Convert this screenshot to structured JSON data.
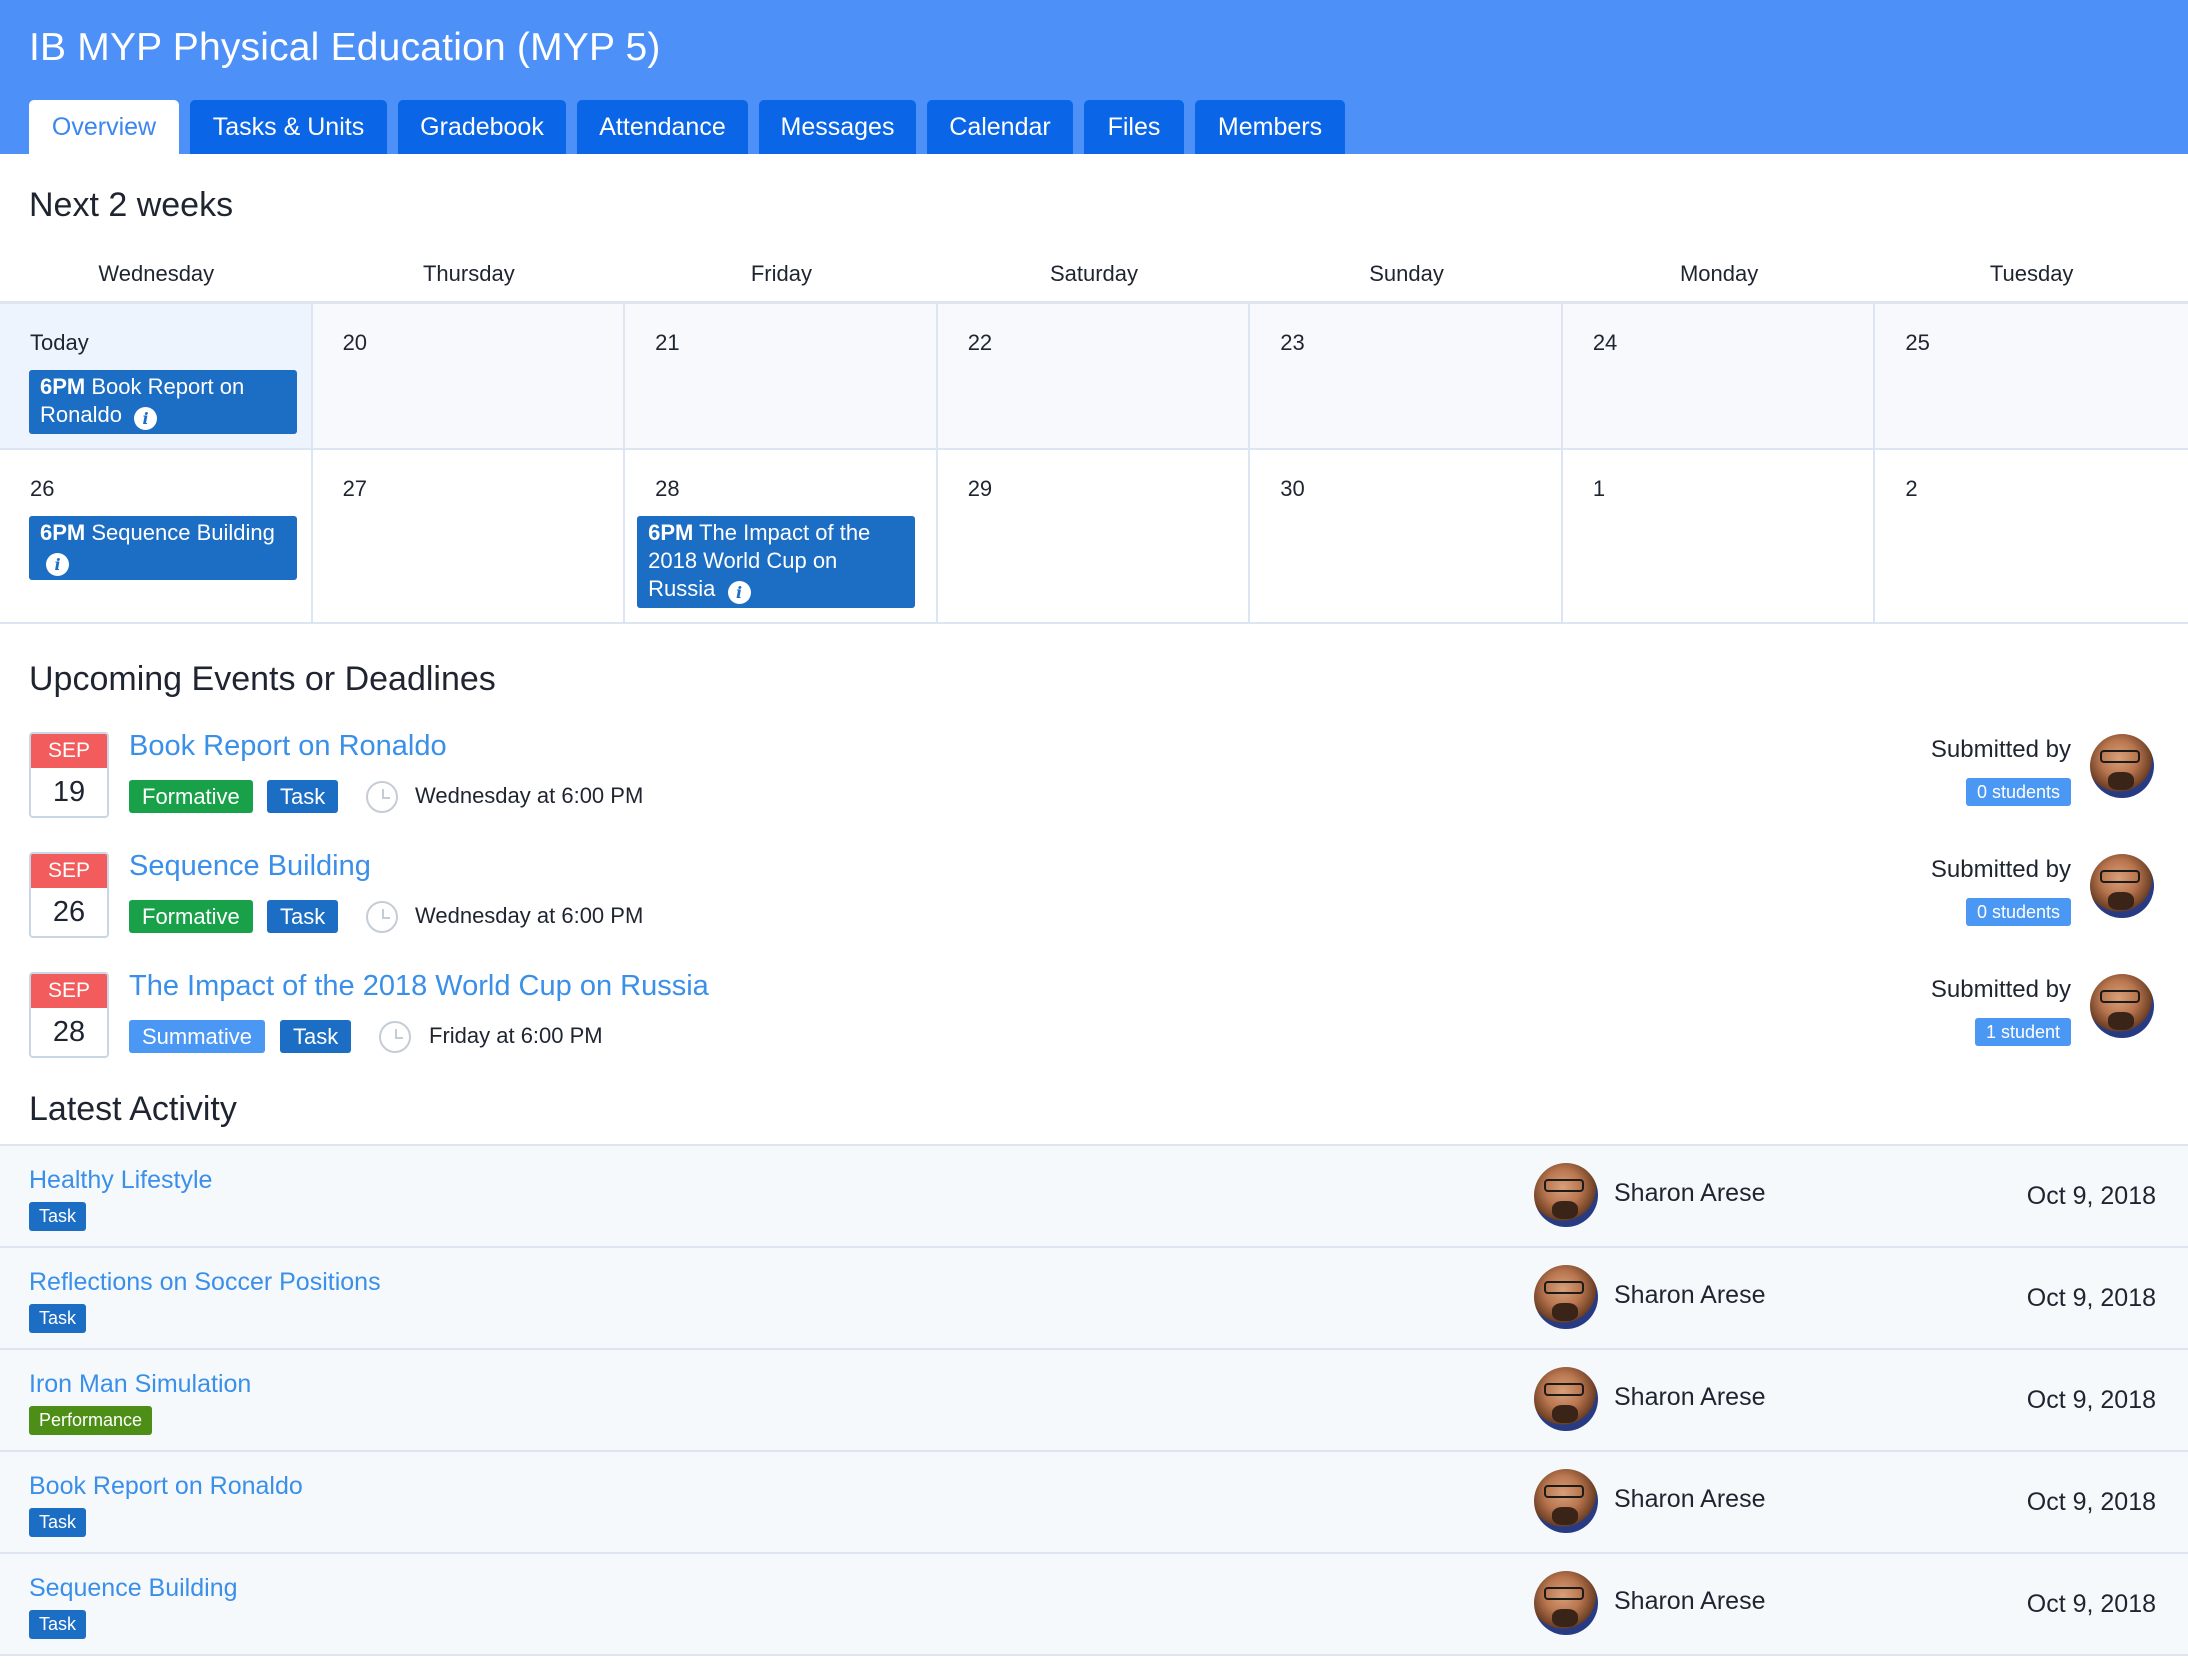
{
  "course": {
    "title": "IB MYP Physical Education (MYP 5)"
  },
  "tabs": [
    {
      "label": "Overview"
    },
    {
      "label": "Tasks & Units"
    },
    {
      "label": "Gradebook"
    },
    {
      "label": "Attendance"
    },
    {
      "label": "Messages"
    },
    {
      "label": "Calendar"
    },
    {
      "label": "Files"
    },
    {
      "label": "Members"
    }
  ],
  "active_tab": "Overview",
  "calendar": {
    "heading": "Next 2 weeks",
    "weekdays": [
      "Wednesday",
      "Thursday",
      "Friday",
      "Saturday",
      "Sunday",
      "Monday",
      "Tuesday"
    ],
    "week1": [
      "Today",
      "20",
      "21",
      "22",
      "23",
      "24",
      "25"
    ],
    "week2": [
      "26",
      "27",
      "28",
      "29",
      "30",
      "1",
      "2"
    ],
    "events": [
      {
        "time": "6PM",
        "title": "Book Report on Ronaldo"
      },
      {
        "time": "6PM",
        "title": "Sequence Building"
      },
      {
        "time": "6PM",
        "title": "The Impact of the 2018 World Cup on Russia"
      }
    ],
    "info_glyph": "i"
  },
  "upcoming": {
    "heading": "Upcoming Events or Deadlines",
    "submitted_label": "Submitted by",
    "items": [
      {
        "month": "SEP",
        "day": "19",
        "title": "Book Report on Ronaldo",
        "type": "Formative",
        "kind": "Task",
        "due": "Wednesday at 6:00 PM",
        "submitted": "0 students"
      },
      {
        "month": "SEP",
        "day": "26",
        "title": "Sequence Building",
        "type": "Formative",
        "kind": "Task",
        "due": "Wednesday at 6:00 PM",
        "submitted": "0 students"
      },
      {
        "month": "SEP",
        "day": "28",
        "title": "The Impact of the 2018 World Cup on Russia",
        "type": "Summative",
        "kind": "Task",
        "due": "Friday at 6:00 PM",
        "submitted": "1 student"
      }
    ]
  },
  "activity": {
    "heading": "Latest Activity",
    "items": [
      {
        "title": "Healthy Lifestyle",
        "tag": "Task",
        "user": "Sharon Arese",
        "date": "Oct 9, 2018"
      },
      {
        "title": "Reflections on Soccer Positions",
        "tag": "Task",
        "user": "Sharon Arese",
        "date": "Oct 9, 2018"
      },
      {
        "title": "Iron Man Simulation",
        "tag": "Performance",
        "user": "Sharon Arese",
        "date": "Oct 9, 2018"
      },
      {
        "title": "Book Report on Ronaldo",
        "tag": "Task",
        "user": "Sharon Arese",
        "date": "Oct 9, 2018"
      },
      {
        "title": "Sequence Building",
        "tag": "Task",
        "user": "Sharon Arese",
        "date": "Oct 9, 2018"
      }
    ]
  },
  "colors": {
    "header_bg": "#4d90f8",
    "tab_bg": "#0a66e6",
    "event_bg": "#1c6dc4",
    "link": "#3a8fe8",
    "formative": "#19a14a",
    "summative": "#4b97f4",
    "performance": "#4d8e16",
    "month_badge": "#f25c5c"
  },
  "icons": [
    "info-icon",
    "clock-icon",
    "avatar"
  ]
}
